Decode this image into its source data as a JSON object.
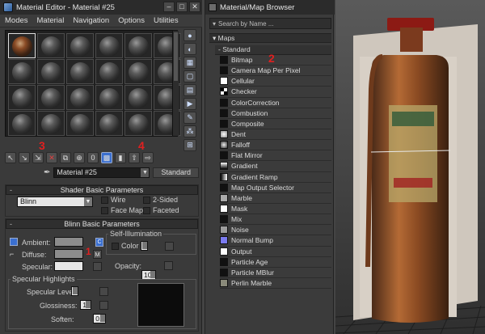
{
  "material_editor": {
    "title": "Material Editor - Material #25",
    "window_buttons": [
      "–",
      "□",
      "✕"
    ],
    "menu": [
      "Modes",
      "Material",
      "Navigation",
      "Options",
      "Utilities"
    ],
    "material_name": "Material #25",
    "material_type": "Standard",
    "annotations": {
      "n3": "3",
      "n4": "4",
      "n1": "1"
    },
    "shader": {
      "header": "Shader Basic Parameters",
      "shader_value": "Blinn",
      "wire": "Wire",
      "two_sided": "2-Sided",
      "face_map": "Face Map",
      "faceted": "Faceted"
    },
    "blinn": {
      "header": "Blinn Basic Parameters",
      "self_illum_group": "Self-Illumination",
      "color_label": "Color",
      "color_value": "0",
      "ambient": "Ambient:",
      "diffuse": "Diffuse:",
      "specular": "Specular:",
      "m_label": "M",
      "opacity_label": "Opacity:",
      "opacity_value": "100",
      "highlights_group": "Specular Highlights",
      "specular_level": "Specular Level:",
      "specular_level_value": "0",
      "glossiness": "Glossiness:",
      "glossiness_value": "10",
      "soften": "Soften:",
      "soften_value": "0.1"
    },
    "colors": {
      "ambient": "#8c8c8c",
      "diffuse": "#8c8c8c",
      "specular": "#e8e8e8",
      "accent": "#3a6fd0",
      "annotation": "#e02020"
    }
  },
  "browser": {
    "title": "Material/Map Browser",
    "search_placeholder": "Search by Name ...",
    "section": "Maps",
    "group": "Standard",
    "annotation_2": "2",
    "items": [
      {
        "label": "Bitmap",
        "icon": "bitmap-icon",
        "color": "#111111"
      },
      {
        "label": "Camera Map Per Pixel",
        "icon": "camera-map-icon",
        "color": "#111111"
      },
      {
        "label": "Cellular",
        "icon": "cellular-icon",
        "color": "#ffffff"
      },
      {
        "label": "Checker",
        "icon": "checker-icon",
        "color": "#ffffff"
      },
      {
        "label": "ColorCorrection",
        "icon": "color-correction-icon",
        "color": "#111111"
      },
      {
        "label": "Combustion",
        "icon": "combustion-icon",
        "color": "#111111"
      },
      {
        "label": "Composite",
        "icon": "composite-icon",
        "color": "#111111"
      },
      {
        "label": "Dent",
        "icon": "dent-icon",
        "color": "#d8d8d8"
      },
      {
        "label": "Falloff",
        "icon": "falloff-icon",
        "color": "#bdbdbd"
      },
      {
        "label": "Flat Mirror",
        "icon": "flat-mirror-icon",
        "color": "#111111"
      },
      {
        "label": "Gradient",
        "icon": "gradient-icon",
        "color": "#808080"
      },
      {
        "label": "Gradient Ramp",
        "icon": "gradient-ramp-icon",
        "color": "#9a9a9a"
      },
      {
        "label": "Map Output Selector",
        "icon": "map-output-selector-icon",
        "color": "#111111"
      },
      {
        "label": "Marble",
        "icon": "marble-icon",
        "color": "#a9a9a9"
      },
      {
        "label": "Mask",
        "icon": "mask-icon",
        "color": "#ffffff"
      },
      {
        "label": "Mix",
        "icon": "mix-icon",
        "color": "#111111"
      },
      {
        "label": "Noise",
        "icon": "noise-icon",
        "color": "#9c9c9c"
      },
      {
        "label": "Normal Bump",
        "icon": "normal-bump-icon",
        "color": "#7b7bf0"
      },
      {
        "label": "Output",
        "icon": "output-icon",
        "color": "#ffffff"
      },
      {
        "label": "Particle Age",
        "icon": "particle-age-icon",
        "color": "#111111"
      },
      {
        "label": "Particle MBlur",
        "icon": "particle-mblur-icon",
        "color": "#111111"
      },
      {
        "label": "Perlin Marble",
        "icon": "perlin-marble-icon",
        "color": "#8a8a7a"
      }
    ]
  }
}
